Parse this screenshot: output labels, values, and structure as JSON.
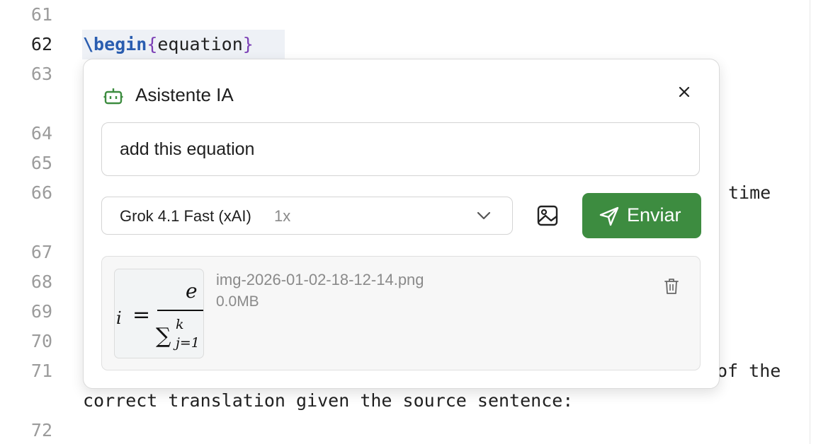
{
  "editor": {
    "line_numbers": [
      "61",
      "62",
      "63",
      "64",
      "65",
      "66",
      "67",
      "68",
      "69",
      "70",
      "71",
      "72"
    ],
    "active_line": "62",
    "begin_command": "\\begin",
    "brace_open": "{",
    "env_name": "equation",
    "brace_close": "}",
    "line66_fragment": "time",
    "line71_fragment": "of the",
    "line71_wrap": "correct translation given the source sentence:"
  },
  "assistant": {
    "icon": "robot-icon",
    "title": "Asistente IA",
    "close_icon": "close-icon",
    "prompt_value": "add this equation",
    "model": {
      "name": "Grok 4.1 Fast (xAI)",
      "multiplier": "1x"
    },
    "image_icon": "image-icon",
    "send_label": "Enviar",
    "send_icon": "send-icon",
    "attachment": {
      "file_name": "img-2026-01-02-18-12-14.png",
      "file_size": "0.0MB",
      "delete_icon": "trash-icon"
    },
    "colors": {
      "accent": "#3d8c40",
      "keyword": "#2a5db0",
      "brace": "#7b3fb5"
    }
  }
}
